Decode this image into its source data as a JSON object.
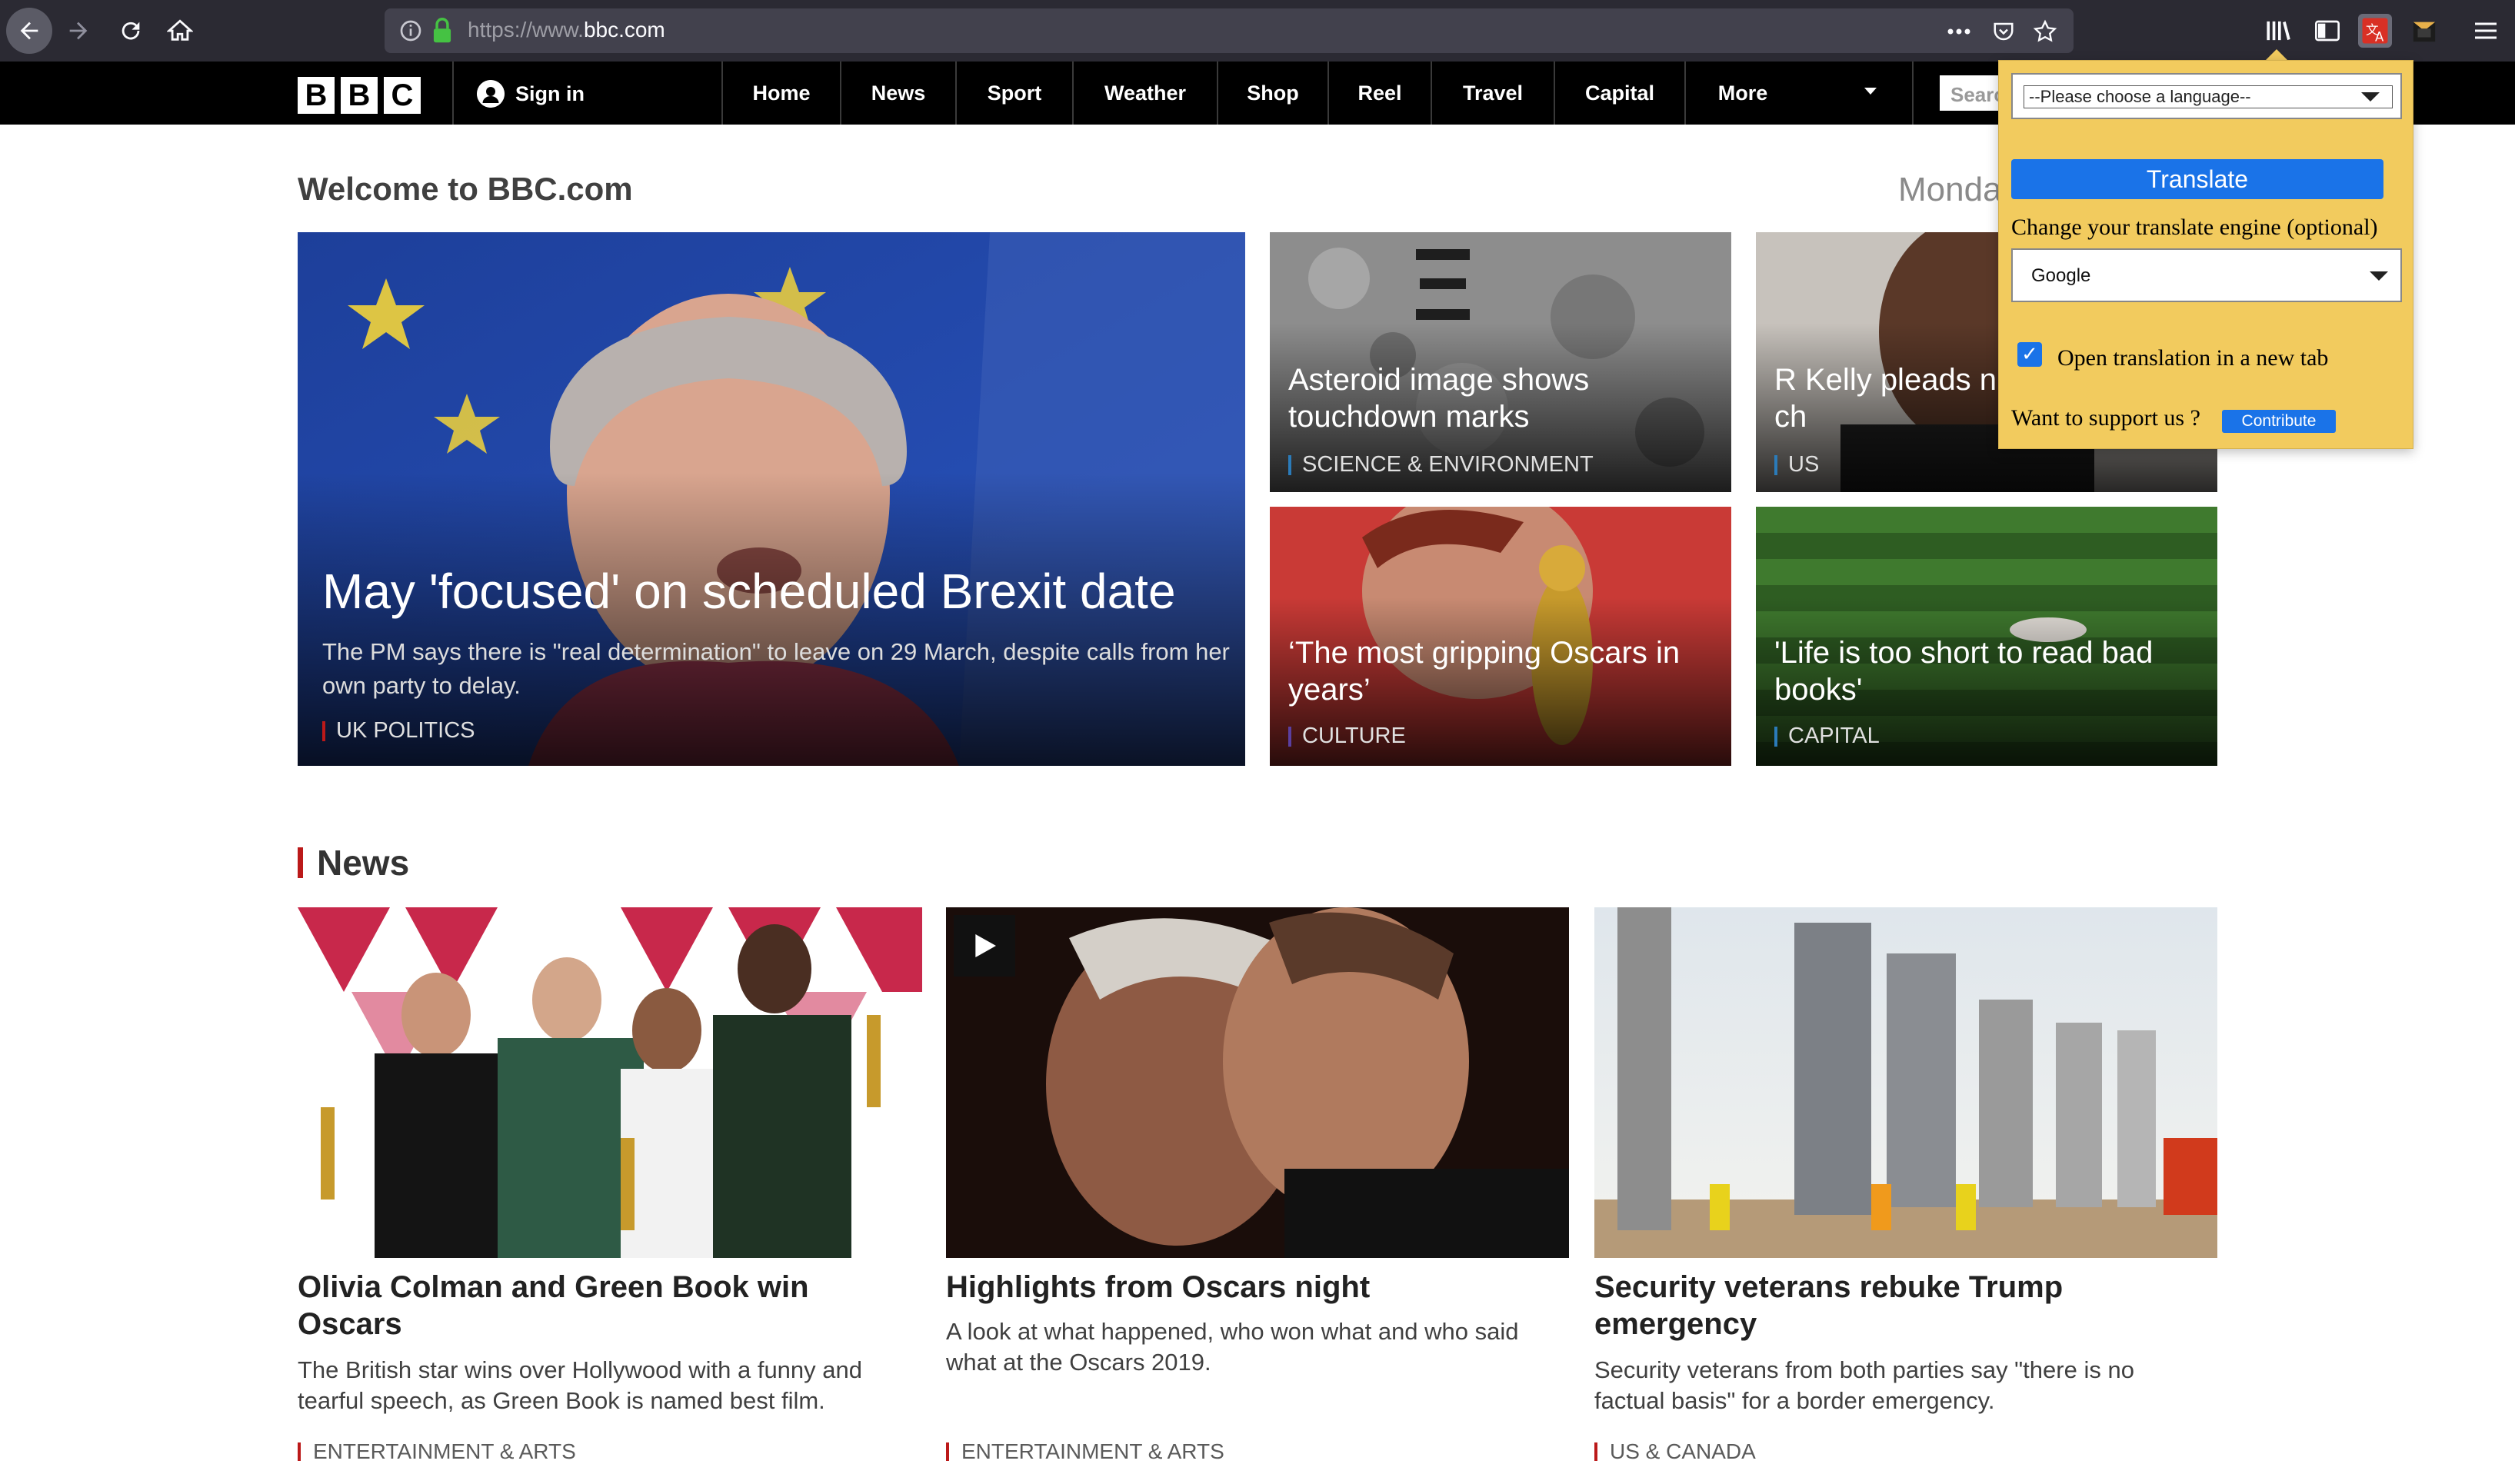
{
  "browser": {
    "url_dim": "https://www.",
    "url_host": "bbc.com"
  },
  "bbc_nav": {
    "logo_letters": [
      "B",
      "B",
      "C"
    ],
    "sign_in": "Sign in",
    "items": [
      "Home",
      "News",
      "Sport",
      "Weather",
      "Shop",
      "Reel",
      "Travel",
      "Capital",
      "More"
    ],
    "search_placeholder": "Searc"
  },
  "page": {
    "welcome": "Welcome to BBC.com",
    "date": "Monda"
  },
  "promos": {
    "main": {
      "title": "May 'focused' on scheduled Brexit date",
      "summary": "The PM says there is \"real determination\" to leave on 29 March, despite calls from her own party to delay.",
      "tag": "UK POLITICS",
      "tag_color": "#bb1919"
    },
    "asteroid": {
      "title": "Asteroid image shows touchdown marks",
      "tag": "SCIENCE & ENVIRONMENT",
      "tag_color": "#2b7bb9"
    },
    "rkelly": {
      "title": "R Kelly pleads n sexual abuse ch",
      "tag": "US",
      "tag_color": "#2b7bb9"
    },
    "oscars": {
      "title": "‘The most gripping Oscars in years’",
      "tag": "CULTURE",
      "tag_color": "#5b3fa0"
    },
    "books": {
      "title": "'Life is too short to read bad books'",
      "tag": "CAPITAL",
      "tag_color": "#2b7bb9"
    }
  },
  "news": {
    "heading": "News",
    "accent": "#bb1919",
    "items": [
      {
        "title": "Olivia Colman and Green Book win Oscars",
        "summary": "The British star wins over Hollywood with a funny and tearful speech, as Green Book is named best film.",
        "tag": "ENTERTAINMENT & ARTS"
      },
      {
        "title": "Highlights from Oscars night",
        "summary": "A look at what happened, who won what and who said what at the Oscars 2019.",
        "tag": "ENTERTAINMENT & ARTS"
      },
      {
        "title": "Security veterans rebuke Trump emergency",
        "summary": "Security veterans from both parties say \"there is no factual basis\" for a border emergency.",
        "tag": "US & CANADA"
      }
    ]
  },
  "translate_popup": {
    "language_placeholder": "--Please choose a language--",
    "translate_button": "Translate",
    "engine_label": "Change your translate engine (optional)",
    "engine_value": "Google",
    "new_tab_label": "Open translation in a new tab",
    "new_tab_checked": true,
    "support_label": "Want to support us ?",
    "contribute_button": "Contribute"
  }
}
